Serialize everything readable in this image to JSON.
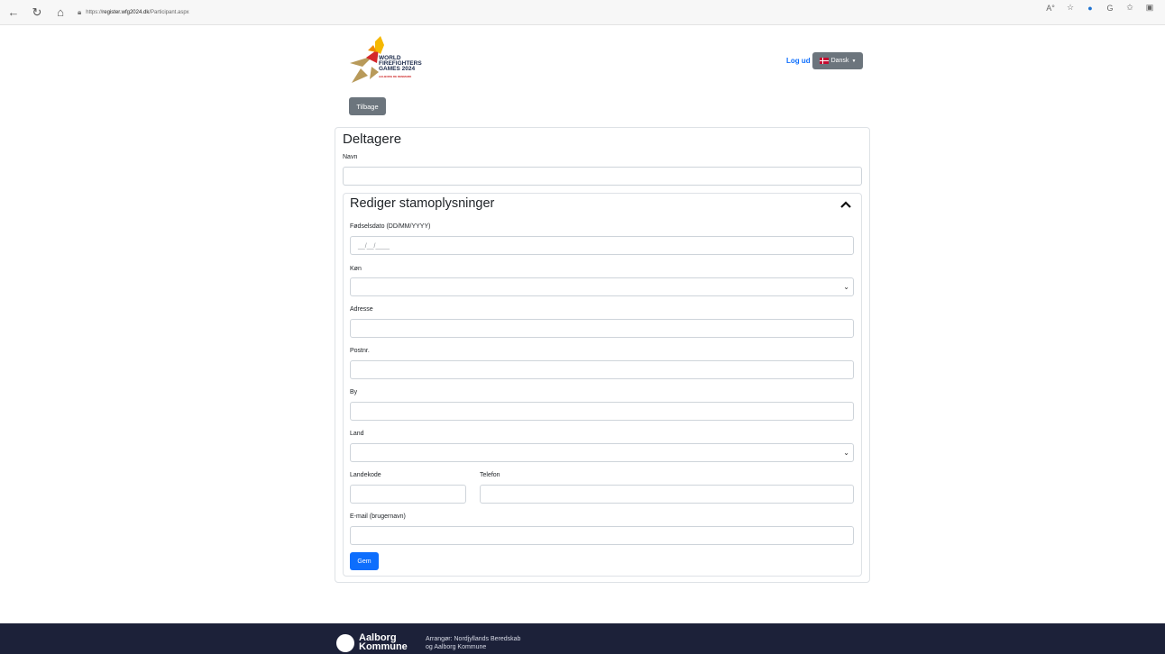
{
  "browser": {
    "url_prefix": "https://",
    "url_host": "register.wfg2024.dk",
    "url_path": "/Participant.aspx"
  },
  "header": {
    "logo_lines": [
      "WORLD",
      "FIREFIGHTERS",
      "GAMES 2024"
    ],
    "logo_sub": "AALBORG DE DENMARK",
    "logout_label": "Log ud",
    "language_label": "Dansk",
    "back_label": "Tilbage"
  },
  "form": {
    "title": "Deltagere",
    "name_label": "Navn",
    "section_title": "Rediger stamoplysninger",
    "birthdate_label": "Fødselsdato (DD/MM/YYYY)",
    "birthdate_placeholder": "__/__/____",
    "gender_label": "Køn",
    "address_label": "Adresse",
    "zip_label": "Postnr.",
    "city_label": "By",
    "country_label": "Land",
    "country_code_label": "Landekode",
    "phone_label": "Telefon",
    "email_label": "E-mail (brugernavn)",
    "save_label": "Gem"
  },
  "footer": {
    "brand_line1": "Aalborg",
    "brand_line2": "Kommune",
    "organizer_line1": "Arrangør: Nordjyllands Beredskab",
    "organizer_line2": "og Aalborg Kommune"
  },
  "colors": {
    "primary": "#0d6efd",
    "secondary": "#6c757d",
    "footer": "#1c2139",
    "logo_gold": "#b89a5a",
    "logo_flame": "#f5b800",
    "logo_red": "#d4272c"
  }
}
